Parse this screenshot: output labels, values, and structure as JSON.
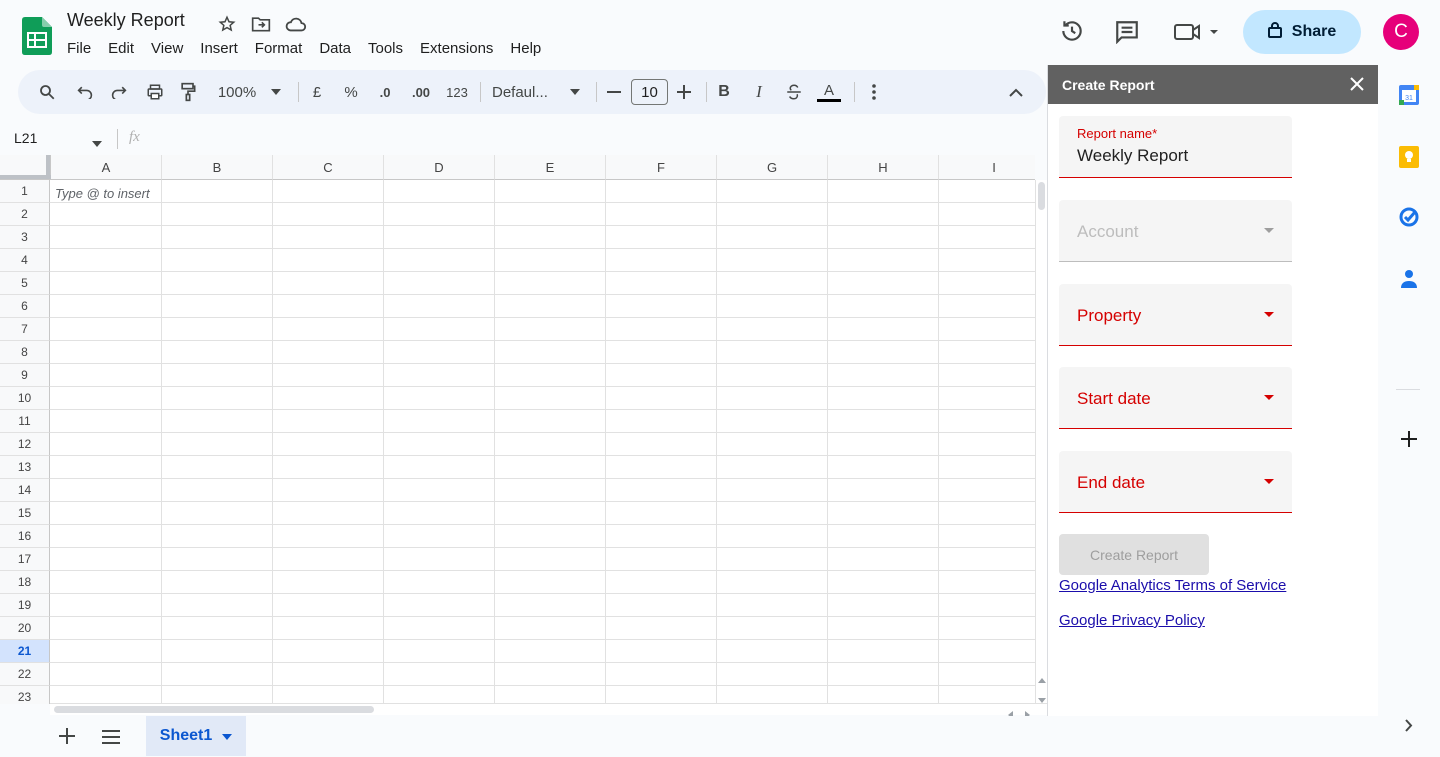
{
  "document": {
    "title": "Weekly Report"
  },
  "menu": [
    "File",
    "Edit",
    "View",
    "Insert",
    "Format",
    "Data",
    "Tools",
    "Extensions",
    "Help"
  ],
  "header": {
    "share_label": "Share",
    "avatar_initial": "C"
  },
  "toolbar": {
    "zoom": "100%",
    "currency": "£",
    "percent": "%",
    "decrease_decimal": ".0",
    "increase_decimal": ".00",
    "number_format": "123",
    "font_family": "Defaul...",
    "font_size": "10",
    "bold": "B",
    "italic": "I",
    "text_color": "A"
  },
  "formula_bar": {
    "name_box": "L21",
    "fx": "fx"
  },
  "grid": {
    "columns": [
      "A",
      "B",
      "C",
      "D",
      "E",
      "F",
      "G",
      "H",
      "I"
    ],
    "rows": [
      "1",
      "2",
      "3",
      "4",
      "5",
      "6",
      "7",
      "8",
      "9",
      "10",
      "11",
      "12",
      "13",
      "14",
      "15",
      "16",
      "17",
      "18",
      "19",
      "20",
      "21",
      "22",
      "23"
    ],
    "selected_row": "21",
    "cell_hint": "Type @ to insert"
  },
  "sheets": {
    "active": "Sheet1"
  },
  "panel": {
    "title": "Create Report",
    "report_name_label": "Report name*",
    "report_name_value": "Weekly Report",
    "account_label": "Account",
    "property_label": "Property",
    "start_date_label": "Start date",
    "end_date_label": "End date",
    "create_button": "Create Report",
    "terms_link": "Google Analytics Terms of Service",
    "privacy_link": "Google Privacy Policy"
  },
  "colors": {
    "error_red": "#d50000",
    "share_bg": "#c2e7ff",
    "avatar_bg": "#e6007a",
    "panel_header": "#616161",
    "sheets_green": "#0f9d58"
  }
}
